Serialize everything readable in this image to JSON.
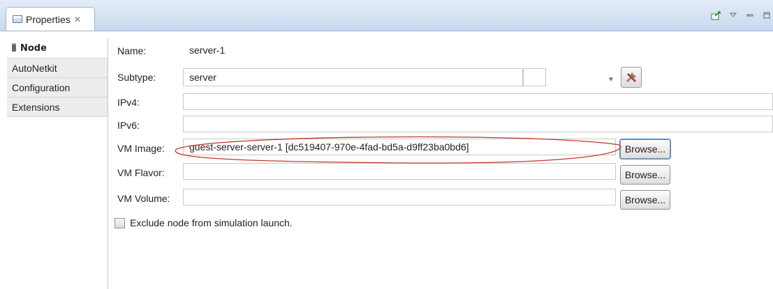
{
  "view": {
    "tab_title": "Properties",
    "tab_close": "✕"
  },
  "sidebar": {
    "items": [
      {
        "label": "Node"
      },
      {
        "label": "AutoNetkit"
      },
      {
        "label": "Configuration"
      },
      {
        "label": "Extensions"
      }
    ]
  },
  "form": {
    "name": {
      "label": "Name:",
      "value": "server-1"
    },
    "subtype": {
      "label": "Subtype:",
      "value": "server"
    },
    "ipv4": {
      "label": "IPv4:",
      "value": ""
    },
    "ipv6": {
      "label": "IPv6:",
      "value": ""
    },
    "vm_image": {
      "label": "VM Image:",
      "value": "guest-server-server-1 [dc519407-970e-4fad-bd5a-d9ff23ba0bd6]",
      "button": "Browse..."
    },
    "vm_flavor": {
      "label": "VM Flavor:",
      "value": "",
      "button": "Browse..."
    },
    "vm_volume": {
      "label": "VM Volume:",
      "value": "",
      "button": "Browse..."
    },
    "exclude": {
      "label": "Exclude node from simulation launch.",
      "checked": false
    }
  },
  "colors": {
    "annotation": "#c0392b",
    "tab_bar": "#c9d9ef"
  }
}
